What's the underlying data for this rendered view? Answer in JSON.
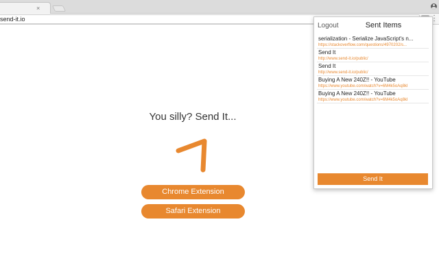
{
  "browser": {
    "url": "send-it.io",
    "tab_close_glyph": "×",
    "icons": {
      "profile": "profile-icon",
      "extension": "send-it-extension-icon",
      "menu": "kebab-menu-icon"
    }
  },
  "page": {
    "headline": "You silly? Send It...",
    "chrome_button": "Chrome Extension",
    "safari_button": "Safari Extension",
    "accent_color": "#e8882f"
  },
  "popup": {
    "logout": "Logout",
    "title": "Sent Items",
    "items": [
      {
        "title": "serialization - Serialize JavaScript's n...",
        "url": "https://stackoverflow.com/questions/4970202/s..."
      },
      {
        "title": "Send It",
        "url": "http://www.send-it.io/public/"
      },
      {
        "title": "Send It",
        "url": "http://www.send-it.io/public/"
      },
      {
        "title": "Buying A New 240Z!! - YouTube",
        "url": "https://www.youtube.com/watch?v=6M4k5oAq8kI"
      },
      {
        "title": "Buying A New 240Z!! - YouTube",
        "url": "https://www.youtube.com/watch?v=6M4k5oAq8kI"
      }
    ],
    "send_button": "Send It"
  }
}
